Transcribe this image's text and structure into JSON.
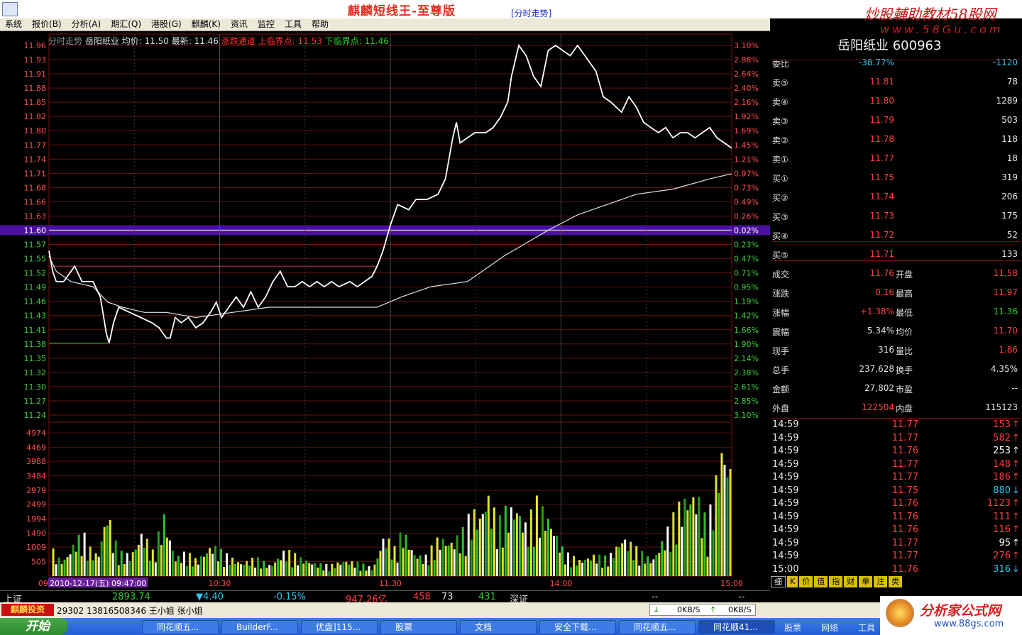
{
  "titlebar": {
    "title": "麒麟短线王-至尊版",
    "view": "[分时走势]",
    "watermark_top": "炒股輔助教材58股网",
    "watermark_url": "www.58Gu.com"
  },
  "menu": [
    "系统",
    "报价(B)",
    "分析(A)",
    "期汇(Q)",
    "港股(G)",
    "麒麟(K)",
    "资讯",
    "监控",
    "工具",
    "帮助"
  ],
  "chart": {
    "info": {
      "label": "分时走势",
      "name": "岳阳纸业",
      "avg": "均价: 11.50",
      "latest": "最新: 11.46",
      "channel": "涨跌通道",
      "upper": "上临界点: 11.53",
      "lower": "下临界点: 11.46"
    },
    "date_label": "2010-12-17(五) 09:47:00",
    "time_prefix": "09",
    "time_ticks": [
      "10:30",
      "11:30",
      "14:00",
      "15:00"
    ]
  },
  "chart_data": {
    "type": "line",
    "price_axis": [
      "11.96",
      "11.93",
      "11.91",
      "11.88",
      "11.85",
      "11.82",
      "11.80",
      "11.77",
      "11.74",
      "11.71",
      "11.68",
      "11.66",
      "11.63",
      "11.60",
      "11.57",
      "11.55",
      "11.52",
      "11.49",
      "11.46",
      "11.43",
      "11.41",
      "11.38",
      "11.35",
      "11.32",
      "11.30",
      "11.27",
      "11.24"
    ],
    "pct_axis": [
      "3.10%",
      "2.88%",
      "2.64%",
      "2.40%",
      "2.16%",
      "1.92%",
      "1.69%",
      "1.45%",
      "1.21%",
      "0.97%",
      "0.73%",
      "0.49%",
      "0.26%",
      "0.02%",
      "0.23%",
      "0.47%",
      "0.71%",
      "0.95%",
      "1.19%",
      "1.42%",
      "1.66%",
      "1.90%",
      "2.14%",
      "2.38%",
      "2.61%",
      "2.85%",
      "3.10%"
    ],
    "pct_axis_dir": [
      "up",
      "up",
      "up",
      "up",
      "up",
      "up",
      "up",
      "up",
      "up",
      "up",
      "up",
      "up",
      "up",
      "up",
      "down",
      "down",
      "down",
      "down",
      "down",
      "down",
      "down",
      "down",
      "down",
      "down",
      "down",
      "down",
      "down"
    ],
    "prev_close": 11.6,
    "price_min": 11.24,
    "price_max": 11.96,
    "volume_axis": [
      "4974",
      "4469",
      "3988",
      "3484",
      "2979",
      "2499",
      "1994",
      "1490",
      "1009",
      "505"
    ],
    "volume_max": 5200,
    "price_series": [
      [
        0,
        11.56
      ],
      [
        5,
        11.52
      ],
      [
        10,
        11.5
      ],
      [
        20,
        11.5
      ],
      [
        35,
        11.53
      ],
      [
        45,
        11.5
      ],
      [
        60,
        11.5
      ],
      [
        70,
        11.47
      ],
      [
        78,
        11.4
      ],
      [
        82,
        11.38
      ],
      [
        88,
        11.42
      ],
      [
        95,
        11.45
      ],
      [
        110,
        11.44
      ],
      [
        125,
        11.43
      ],
      [
        140,
        11.42
      ],
      [
        150,
        11.41
      ],
      [
        160,
        11.39
      ],
      [
        165,
        11.39
      ],
      [
        172,
        11.43
      ],
      [
        180,
        11.42
      ],
      [
        190,
        11.43
      ],
      [
        200,
        11.41
      ],
      [
        210,
        11.42
      ],
      [
        220,
        11.44
      ],
      [
        228,
        11.46
      ],
      [
        235,
        11.43
      ],
      [
        245,
        11.45
      ],
      [
        255,
        11.47
      ],
      [
        265,
        11.45
      ],
      [
        275,
        11.48
      ],
      [
        285,
        11.45
      ],
      [
        295,
        11.47
      ],
      [
        305,
        11.5
      ],
      [
        315,
        11.52
      ],
      [
        325,
        11.49
      ],
      [
        335,
        11.49
      ],
      [
        345,
        11.5
      ],
      [
        355,
        11.49
      ],
      [
        365,
        11.5
      ],
      [
        375,
        11.49
      ],
      [
        385,
        11.5
      ],
      [
        395,
        11.49
      ],
      [
        410,
        11.5
      ],
      [
        420,
        11.49
      ],
      [
        430,
        11.5
      ],
      [
        440,
        11.51
      ],
      [
        447,
        11.53
      ],
      [
        455,
        11.56
      ],
      [
        465,
        11.61
      ],
      [
        475,
        11.65
      ],
      [
        490,
        11.64
      ],
      [
        500,
        11.66
      ],
      [
        515,
        11.66
      ],
      [
        530,
        11.67
      ],
      [
        540,
        11.7
      ],
      [
        550,
        11.78
      ],
      [
        555,
        11.81
      ],
      [
        560,
        11.77
      ],
      [
        570,
        11.78
      ],
      [
        580,
        11.79
      ],
      [
        595,
        11.79
      ],
      [
        605,
        11.8
      ],
      [
        615,
        11.82
      ],
      [
        625,
        11.85
      ],
      [
        630,
        11.9
      ],
      [
        640,
        11.96
      ],
      [
        650,
        11.94
      ],
      [
        660,
        11.9
      ],
      [
        670,
        11.88
      ],
      [
        680,
        11.95
      ],
      [
        690,
        11.96
      ],
      [
        700,
        11.95
      ],
      [
        710,
        11.94
      ],
      [
        720,
        11.96
      ],
      [
        730,
        11.94
      ],
      [
        745,
        11.91
      ],
      [
        755,
        11.86
      ],
      [
        765,
        11.85
      ],
      [
        780,
        11.83
      ],
      [
        790,
        11.86
      ],
      [
        800,
        11.84
      ],
      [
        810,
        11.81
      ],
      [
        820,
        11.8
      ],
      [
        830,
        11.79
      ],
      [
        840,
        11.8
      ],
      [
        850,
        11.78
      ],
      [
        860,
        11.79
      ],
      [
        870,
        11.79
      ],
      [
        880,
        11.78
      ],
      [
        890,
        11.79
      ],
      [
        900,
        11.8
      ],
      [
        910,
        11.78
      ],
      [
        920,
        11.77
      ],
      [
        930,
        11.76
      ]
    ],
    "avg_series": [
      [
        0,
        11.55
      ],
      [
        10,
        11.52
      ],
      [
        30,
        11.5
      ],
      [
        60,
        11.49
      ],
      [
        80,
        11.46
      ],
      [
        100,
        11.45
      ],
      [
        130,
        11.44
      ],
      [
        160,
        11.44
      ],
      [
        200,
        11.43
      ],
      [
        250,
        11.44
      ],
      [
        300,
        11.45
      ],
      [
        400,
        11.45
      ],
      [
        447,
        11.45
      ],
      [
        480,
        11.47
      ],
      [
        520,
        11.49
      ],
      [
        570,
        11.5
      ],
      [
        620,
        11.55
      ],
      [
        680,
        11.6
      ],
      [
        720,
        11.63
      ],
      [
        760,
        11.65
      ],
      [
        800,
        11.67
      ],
      [
        850,
        11.68
      ],
      [
        900,
        11.7
      ],
      [
        930,
        11.71
      ]
    ],
    "upper_channel": [
      [
        0,
        11.53
      ],
      [
        447,
        11.53
      ]
    ],
    "lower_channel": [
      [
        0,
        11.38
      ],
      [
        80,
        11.38
      ]
    ],
    "volume_series": [
      [
        3,
        1000
      ],
      [
        10,
        700
      ],
      [
        18,
        600
      ],
      [
        25,
        900
      ],
      [
        35,
        1400
      ],
      [
        45,
        1600
      ],
      [
        55,
        1000
      ],
      [
        65,
        800
      ],
      [
        78,
        2600
      ],
      [
        85,
        1500
      ],
      [
        95,
        900
      ],
      [
        110,
        800
      ],
      [
        125,
        1700
      ],
      [
        140,
        900
      ],
      [
        155,
        2300
      ],
      [
        170,
        700
      ],
      [
        185,
        900
      ],
      [
        200,
        600
      ],
      [
        220,
        1200
      ],
      [
        240,
        800
      ],
      [
        260,
        500
      ],
      [
        280,
        700
      ],
      [
        300,
        400
      ],
      [
        320,
        1000
      ],
      [
        340,
        700
      ],
      [
        360,
        500
      ],
      [
        380,
        400
      ],
      [
        400,
        600
      ],
      [
        420,
        500
      ],
      [
        440,
        300
      ],
      [
        455,
        1600
      ],
      [
        470,
        1000
      ],
      [
        480,
        1800
      ],
      [
        495,
        900
      ],
      [
        510,
        700
      ],
      [
        530,
        1500
      ],
      [
        545,
        1300
      ],
      [
        560,
        1600
      ],
      [
        575,
        2500
      ],
      [
        585,
        2300
      ],
      [
        595,
        3200
      ],
      [
        610,
        2000
      ],
      [
        620,
        2500
      ],
      [
        635,
        2700
      ],
      [
        650,
        1800
      ],
      [
        660,
        2900
      ],
      [
        680,
        2200
      ],
      [
        700,
        900
      ],
      [
        720,
        600
      ],
      [
        740,
        800
      ],
      [
        760,
        700
      ],
      [
        780,
        1500
      ],
      [
        800,
        1000
      ],
      [
        820,
        600
      ],
      [
        840,
        1700
      ],
      [
        855,
        2600
      ],
      [
        865,
        3000
      ],
      [
        880,
        3200
      ],
      [
        895,
        1900
      ],
      [
        905,
        3400
      ],
      [
        915,
        5000
      ],
      [
        925,
        4400
      ],
      [
        935,
        1700
      ],
      [
        940,
        4400
      ]
    ]
  },
  "stock": {
    "name_code": "岳阳纸业 600963"
  },
  "order_book": [
    {
      "label": "委比",
      "price": "-38.77%",
      "vol": "-1120"
    },
    {
      "label": "卖⑤",
      "price": "11.81",
      "vol": "78"
    },
    {
      "label": "卖④",
      "price": "11.80",
      "vol": "1289"
    },
    {
      "label": "卖③",
      "price": "11.79",
      "vol": "503"
    },
    {
      "label": "卖②",
      "price": "11.78",
      "vol": "118"
    },
    {
      "label": "卖①",
      "price": "11.77",
      "vol": "18"
    },
    {
      "label": "买①",
      "price": "11.75",
      "vol": "319"
    },
    {
      "label": "买②",
      "price": "11.74",
      "vol": "206"
    },
    {
      "label": "买③",
      "price": "11.73",
      "vol": "175"
    },
    {
      "label": "买④",
      "price": "11.72",
      "vol": "52"
    },
    {
      "label": "买⑤",
      "price": "11.71",
      "vol": "133"
    }
  ],
  "stats": [
    {
      "l1": "成交",
      "v1": "11.76",
      "l2": "开盘",
      "v2": "11.58",
      "c1": "#ff4040",
      "c2": "#ff4040"
    },
    {
      "l1": "涨跌",
      "v1": "0.16",
      "l2": "最高",
      "v2": "11.97",
      "c1": "#ff4040",
      "c2": "#ff4040"
    },
    {
      "l1": "涨幅",
      "v1": "+1.38%",
      "l2": "最低",
      "v2": "11.36",
      "c1": "#ff4040",
      "c2": "#30d030"
    },
    {
      "l1": "震幅",
      "v1": "5.34%",
      "l2": "均价",
      "v2": "11.70",
      "c1": "#e0e0e0",
      "c2": "#ff4040"
    },
    {
      "l1": "现手",
      "v1": "316",
      "l2": "量比",
      "v2": "1.86",
      "c1": "#e0e0e0",
      "c2": "#ff4040"
    },
    {
      "l1": "总手",
      "v1": "237,628",
      "l2": "换手",
      "v2": "4.35%",
      "c1": "#e0e0e0",
      "c2": "#e0e0e0"
    },
    {
      "l1": "金额",
      "v1": "27,802",
      "l2": "市盈",
      "v2": "--",
      "c1": "#e0e0e0",
      "c2": "#e0e0e0"
    },
    {
      "l1": "外盘",
      "v1": "122504",
      "l2": "内盘",
      "v2": "115123",
      "c1": "#ff4040",
      "c2": "#e0e0e0"
    }
  ],
  "ticks": [
    {
      "time": "14:59",
      "price": "11.77",
      "vol": "153",
      "dir": "up"
    },
    {
      "time": "14:59",
      "price": "11.77",
      "vol": "582",
      "dir": "up"
    },
    {
      "time": "14:59",
      "price": "11.76",
      "vol": "253",
      "dir": "upw"
    },
    {
      "time": "14:59",
      "price": "11.77",
      "vol": "148",
      "dir": "up"
    },
    {
      "time": "14:59",
      "price": "11.77",
      "vol": "186",
      "dir": "up"
    },
    {
      "time": "14:59",
      "price": "11.75",
      "vol": "880",
      "dir": "down"
    },
    {
      "time": "14:59",
      "price": "11.76",
      "vol": "1123",
      "dir": "up"
    },
    {
      "time": "14:59",
      "price": "11.76",
      "vol": "111",
      "dir": "up"
    },
    {
      "time": "14:59",
      "price": "11.76",
      "vol": "116",
      "dir": "up"
    },
    {
      "time": "14:59",
      "price": "11.77",
      "vol": "95",
      "dir": "upw"
    },
    {
      "time": "14:59",
      "price": "11.77",
      "vol": "276",
      "dir": "up"
    },
    {
      "time": "15:00",
      "price": "11.76",
      "vol": "316",
      "dir": "down"
    }
  ],
  "tabs": [
    "细",
    "K",
    "价",
    "值",
    "指",
    "财",
    "单",
    "注",
    "类"
  ],
  "index": {
    "name": "上证",
    "value": "2893.74",
    "change": "▼4.40",
    "pct": "-0.15%",
    "amount": "947.26亿",
    "up": "458",
    "flat": "73",
    "down": "431",
    "name2": "深证",
    "d1": "--",
    "d2": "--"
  },
  "bottom": {
    "logo": "麒麟投资",
    "phone": "29302  13816508346  王小姐  张小姐",
    "net_down": "0KB/S",
    "net_up": "0KB/S"
  },
  "taskbar": {
    "start": "开始",
    "items": [
      "同花顺五...",
      "BuilderF...",
      "优盘]115...",
      "股票",
      "文档",
      "安全下载...",
      "同花顺五...",
      "同花顺41..."
    ],
    "tray": [
      "股票",
      "网络",
      "工具"
    ]
  },
  "brand": {
    "name": "分析家公式网",
    "url": "www.88gs.com"
  }
}
